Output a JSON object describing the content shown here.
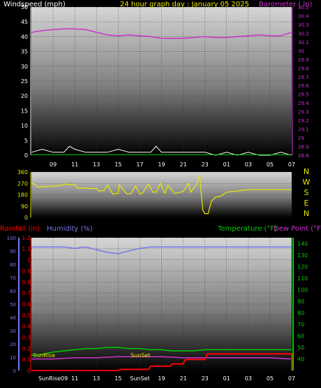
{
  "chart_data": [
    {
      "type": "line",
      "title": "24 hour graph day : January 05 2025",
      "left_axis_label": "Windspeed (mph)",
      "right_axis_label": "Barometer ( in)",
      "x_ticks": [
        "09",
        "11",
        "13",
        "15",
        "17",
        "19",
        "21",
        "23",
        "01",
        "03",
        "05",
        "07"
      ],
      "x_hour_start": 7,
      "x_hour_end": 31,
      "left_ylim": [
        0,
        50
      ],
      "left_yticks": [
        "0",
        "5",
        "10",
        "15",
        "20",
        "25",
        "30",
        "35",
        "40",
        "45",
        "50"
      ],
      "right_ylim": [
        28.8,
        30.5
      ],
      "right_yticks": [
        "28.8",
        "28.9",
        "29",
        "29.1",
        "29.2",
        "29.3",
        "29.4",
        "29.5",
        "29.6",
        "29.7",
        "29.8",
        "29.9",
        "30",
        "30.1",
        "30.2",
        "30.3",
        "30.4",
        "30.5"
      ],
      "grid": true,
      "series": [
        {
          "name": "Barometer ( in)",
          "axis": "right",
          "color": "#cc33cc",
          "x": [
            7,
            8,
            9,
            10,
            11,
            12,
            13,
            14,
            15,
            16,
            17,
            18,
            19,
            20,
            21,
            22,
            23,
            24,
            25,
            26,
            27,
            28,
            29,
            30,
            31
          ],
          "y": [
            30.21,
            30.23,
            30.24,
            30.25,
            30.25,
            30.24,
            30.21,
            30.18,
            30.17,
            30.18,
            30.17,
            30.16,
            30.14,
            30.14,
            30.14,
            30.15,
            30.16,
            30.15,
            30.15,
            30.16,
            30.17,
            30.18,
            30.17,
            30.17,
            30.21
          ]
        },
        {
          "name": "Windspeed (mph)",
          "axis": "left",
          "color": "#ffffff",
          "x": [
            7,
            8,
            9,
            10,
            10.5,
            11,
            12,
            13,
            14,
            15,
            16,
            17,
            18,
            18.5,
            19,
            20,
            21,
            22,
            23,
            24,
            25,
            26,
            27,
            28,
            29,
            30,
            31
          ],
          "y": [
            1,
            2,
            1,
            1,
            3,
            2,
            1,
            1,
            1,
            2,
            1,
            1,
            1,
            3,
            1,
            1,
            1,
            1,
            1,
            0,
            1,
            0,
            1,
            0,
            0,
            1,
            0
          ]
        },
        {
          "name": "Wind gust",
          "axis": "left",
          "color": "#00cc00",
          "x": [
            7,
            31
          ],
          "y": [
            0.2,
            0.2
          ]
        }
      ]
    },
    {
      "type": "line",
      "series_name": "Wind Direction",
      "color": "#e8e800",
      "ylim": [
        0,
        360
      ],
      "yticks": [
        "0",
        "90",
        "180",
        "270",
        "360"
      ],
      "compass_labels": [
        "N",
        "W",
        "S",
        "E",
        "N"
      ],
      "x_hour_start": 7,
      "x_hour_end": 31,
      "x": [
        7,
        7.3,
        7.6,
        9,
        9.5,
        10,
        10.6,
        11,
        11.2,
        12,
        12.5,
        13,
        13.2,
        13.7,
        14,
        14.5,
        15,
        15.1,
        15.8,
        16.2,
        16.6,
        17,
        17.2,
        17.8,
        18.2,
        18.5,
        18.9,
        19.3,
        19.6,
        20.2,
        20.5,
        21,
        21.5,
        21.7,
        22.3,
        22.5,
        22.8,
        23,
        23.3,
        23.6,
        24,
        24.5,
        25,
        26,
        27,
        28,
        29,
        30,
        31
      ],
      "y": [
        270,
        265,
        240,
        248,
        250,
        265,
        258,
        262,
        232,
        233,
        229,
        230,
        210,
        213,
        258,
        185,
        190,
        260,
        185,
        190,
        250,
        185,
        190,
        265,
        200,
        200,
        270,
        190,
        255,
        190,
        195,
        205,
        270,
        200,
        270,
        340,
        60,
        30,
        30,
        130,
        160,
        170,
        200,
        210,
        220,
        220,
        220,
        220,
        220
      ]
    },
    {
      "type": "line",
      "labels": {
        "rainfall": "Rainfall (in)",
        "humidity": "Humidity (%)",
        "temperature": "Temperature (°F)",
        "dewpoint": "Dew Point (°F)",
        "sunrise": "SunRise",
        "sunset": "SunSet"
      },
      "x_ticks": [
        "SunRise09",
        "11",
        "13",
        "15",
        "SunSet",
        "19",
        "21",
        "23",
        "01",
        "03",
        "05",
        "07"
      ],
      "x_hour_start": 7,
      "x_hour_end": 31,
      "rain_ylim": [
        0,
        1.2
      ],
      "rain_yticks": [
        "0",
        "0.1",
        "0.2",
        "0.3",
        "0.4",
        "0.5",
        "0.6",
        "0.7",
        "0.8",
        "0.9",
        "1",
        "1.1",
        "1.2"
      ],
      "humidity_ylim": [
        0,
        100
      ],
      "humidity_yticks": [
        "0",
        "10",
        "20",
        "30",
        "40",
        "50",
        "60",
        "70",
        "80",
        "90",
        "100"
      ],
      "temp_ylim": [
        30,
        145
      ],
      "temp_yticks": [
        "40",
        "50",
        "60",
        "70",
        "80",
        "90",
        "100",
        "110",
        "120",
        "130",
        "140"
      ],
      "grid": true,
      "series": [
        {
          "name": "Humidity (%)",
          "axis": "humidity",
          "color": "#7777ee",
          "x": [
            7,
            9,
            10,
            11,
            12,
            13,
            14,
            15,
            16,
            17,
            18,
            20,
            22,
            24,
            26,
            28,
            30,
            31
          ],
          "y": [
            93,
            93,
            93,
            92,
            93,
            91,
            89,
            88,
            90,
            92,
            93,
            93,
            93,
            93,
            93,
            93,
            93,
            93
          ]
        },
        {
          "name": "Temperature (°F)",
          "axis": "temp",
          "color": "#00cc00",
          "x": [
            7,
            8,
            9,
            10,
            11,
            12,
            13,
            14,
            15,
            16,
            17,
            18,
            19,
            20,
            21,
            22,
            23,
            24,
            25,
            26,
            27,
            28,
            29,
            30,
            31
          ],
          "y": [
            43,
            44,
            46,
            47,
            48,
            49,
            49,
            50,
            50,
            49,
            49,
            48,
            48,
            47,
            47,
            47,
            48,
            48,
            48,
            48,
            48,
            48,
            48,
            48,
            48
          ]
        },
        {
          "name": "Dew Point (°F)",
          "axis": "temp",
          "color": "#cc33cc",
          "x": [
            7,
            9,
            11,
            13,
            15,
            17,
            19,
            21,
            23,
            25,
            27,
            29,
            31
          ],
          "y": [
            40,
            40,
            41,
            41,
            42,
            42,
            42,
            41,
            41,
            41,
            41,
            41,
            40
          ]
        },
        {
          "name": "Rainfall (in)",
          "axis": "rain",
          "color": "#ff0000",
          "x": [
            7,
            15,
            15.2,
            17.8,
            18,
            19.8,
            20,
            21,
            21.2,
            23,
            23.2,
            31,
            31
          ],
          "y": [
            0,
            0,
            0.01,
            0.01,
            0.04,
            0.04,
            0.06,
            0.06,
            0.1,
            0.1,
            0.15,
            0.15,
            0
          ]
        }
      ]
    }
  ]
}
